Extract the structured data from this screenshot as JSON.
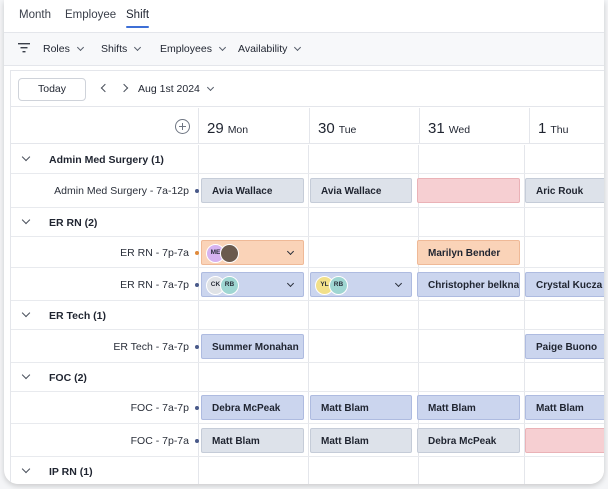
{
  "view_tabs": {
    "month": "Month",
    "employee": "Employee",
    "shift": "Shift"
  },
  "filters": {
    "roles": "Roles",
    "shifts": "Shifts",
    "employees": "Employees",
    "availability": "Availability"
  },
  "toolbar": {
    "today": "Today",
    "date": "Aug 1st 2024"
  },
  "days": [
    {
      "num": "29",
      "name": "Mon"
    },
    {
      "num": "30",
      "name": "Tue"
    },
    {
      "num": "31",
      "name": "Wed"
    },
    {
      "num": "1",
      "name": "Thu"
    }
  ],
  "groups": {
    "admin": "Admin Med Surgery (1)",
    "er_rn": "ER RN (2)",
    "er_tech": "ER Tech (1)",
    "foc": "FOC (2)",
    "ip_rn": "IP RN (1)"
  },
  "slots": {
    "admin": "Admin Med Surgery  - 7a-12p",
    "er_rn_1": "ER RN  - 7p-7a",
    "er_rn_2": "ER RN  - 7a-7p",
    "er_tech": "ER Tech  - 7a-7p",
    "foc_1": "FOC  - 7a-7p",
    "foc_2": "FOC  - 7p-7a"
  },
  "shifts": {
    "admin": [
      "Avia Wallace",
      "Avia Wallace",
      "",
      "Aric Rouk"
    ],
    "er_rn_1": [
      "",
      "",
      "Marilyn Bender",
      ""
    ],
    "er_rn_2": [
      "",
      "",
      "Christopher belknap",
      "Crystal Kucza"
    ],
    "er_tech": [
      "Summer Monahan",
      "",
      "",
      "Paige Buono"
    ],
    "foc_1": [
      "Debra McPeak",
      "Matt Blam",
      "Matt Blam",
      "Matt Blam"
    ],
    "foc_2": [
      "Matt Blam",
      "Matt Blam",
      "Debra McPeak",
      ""
    ]
  },
  "avatars": {
    "er_rn_1_mon": [
      "ME",
      ""
    ],
    "er_rn_2_mon": [
      "CK",
      "RB"
    ],
    "er_rn_2_tue": [
      "YL",
      "RB"
    ]
  },
  "colors": {
    "accent": "#3d6fd6",
    "shift_gray": "#dde2ea",
    "shift_blue": "#cbd5ee",
    "shift_orange": "#fad3b8",
    "shift_red": "#f6cfd2"
  }
}
